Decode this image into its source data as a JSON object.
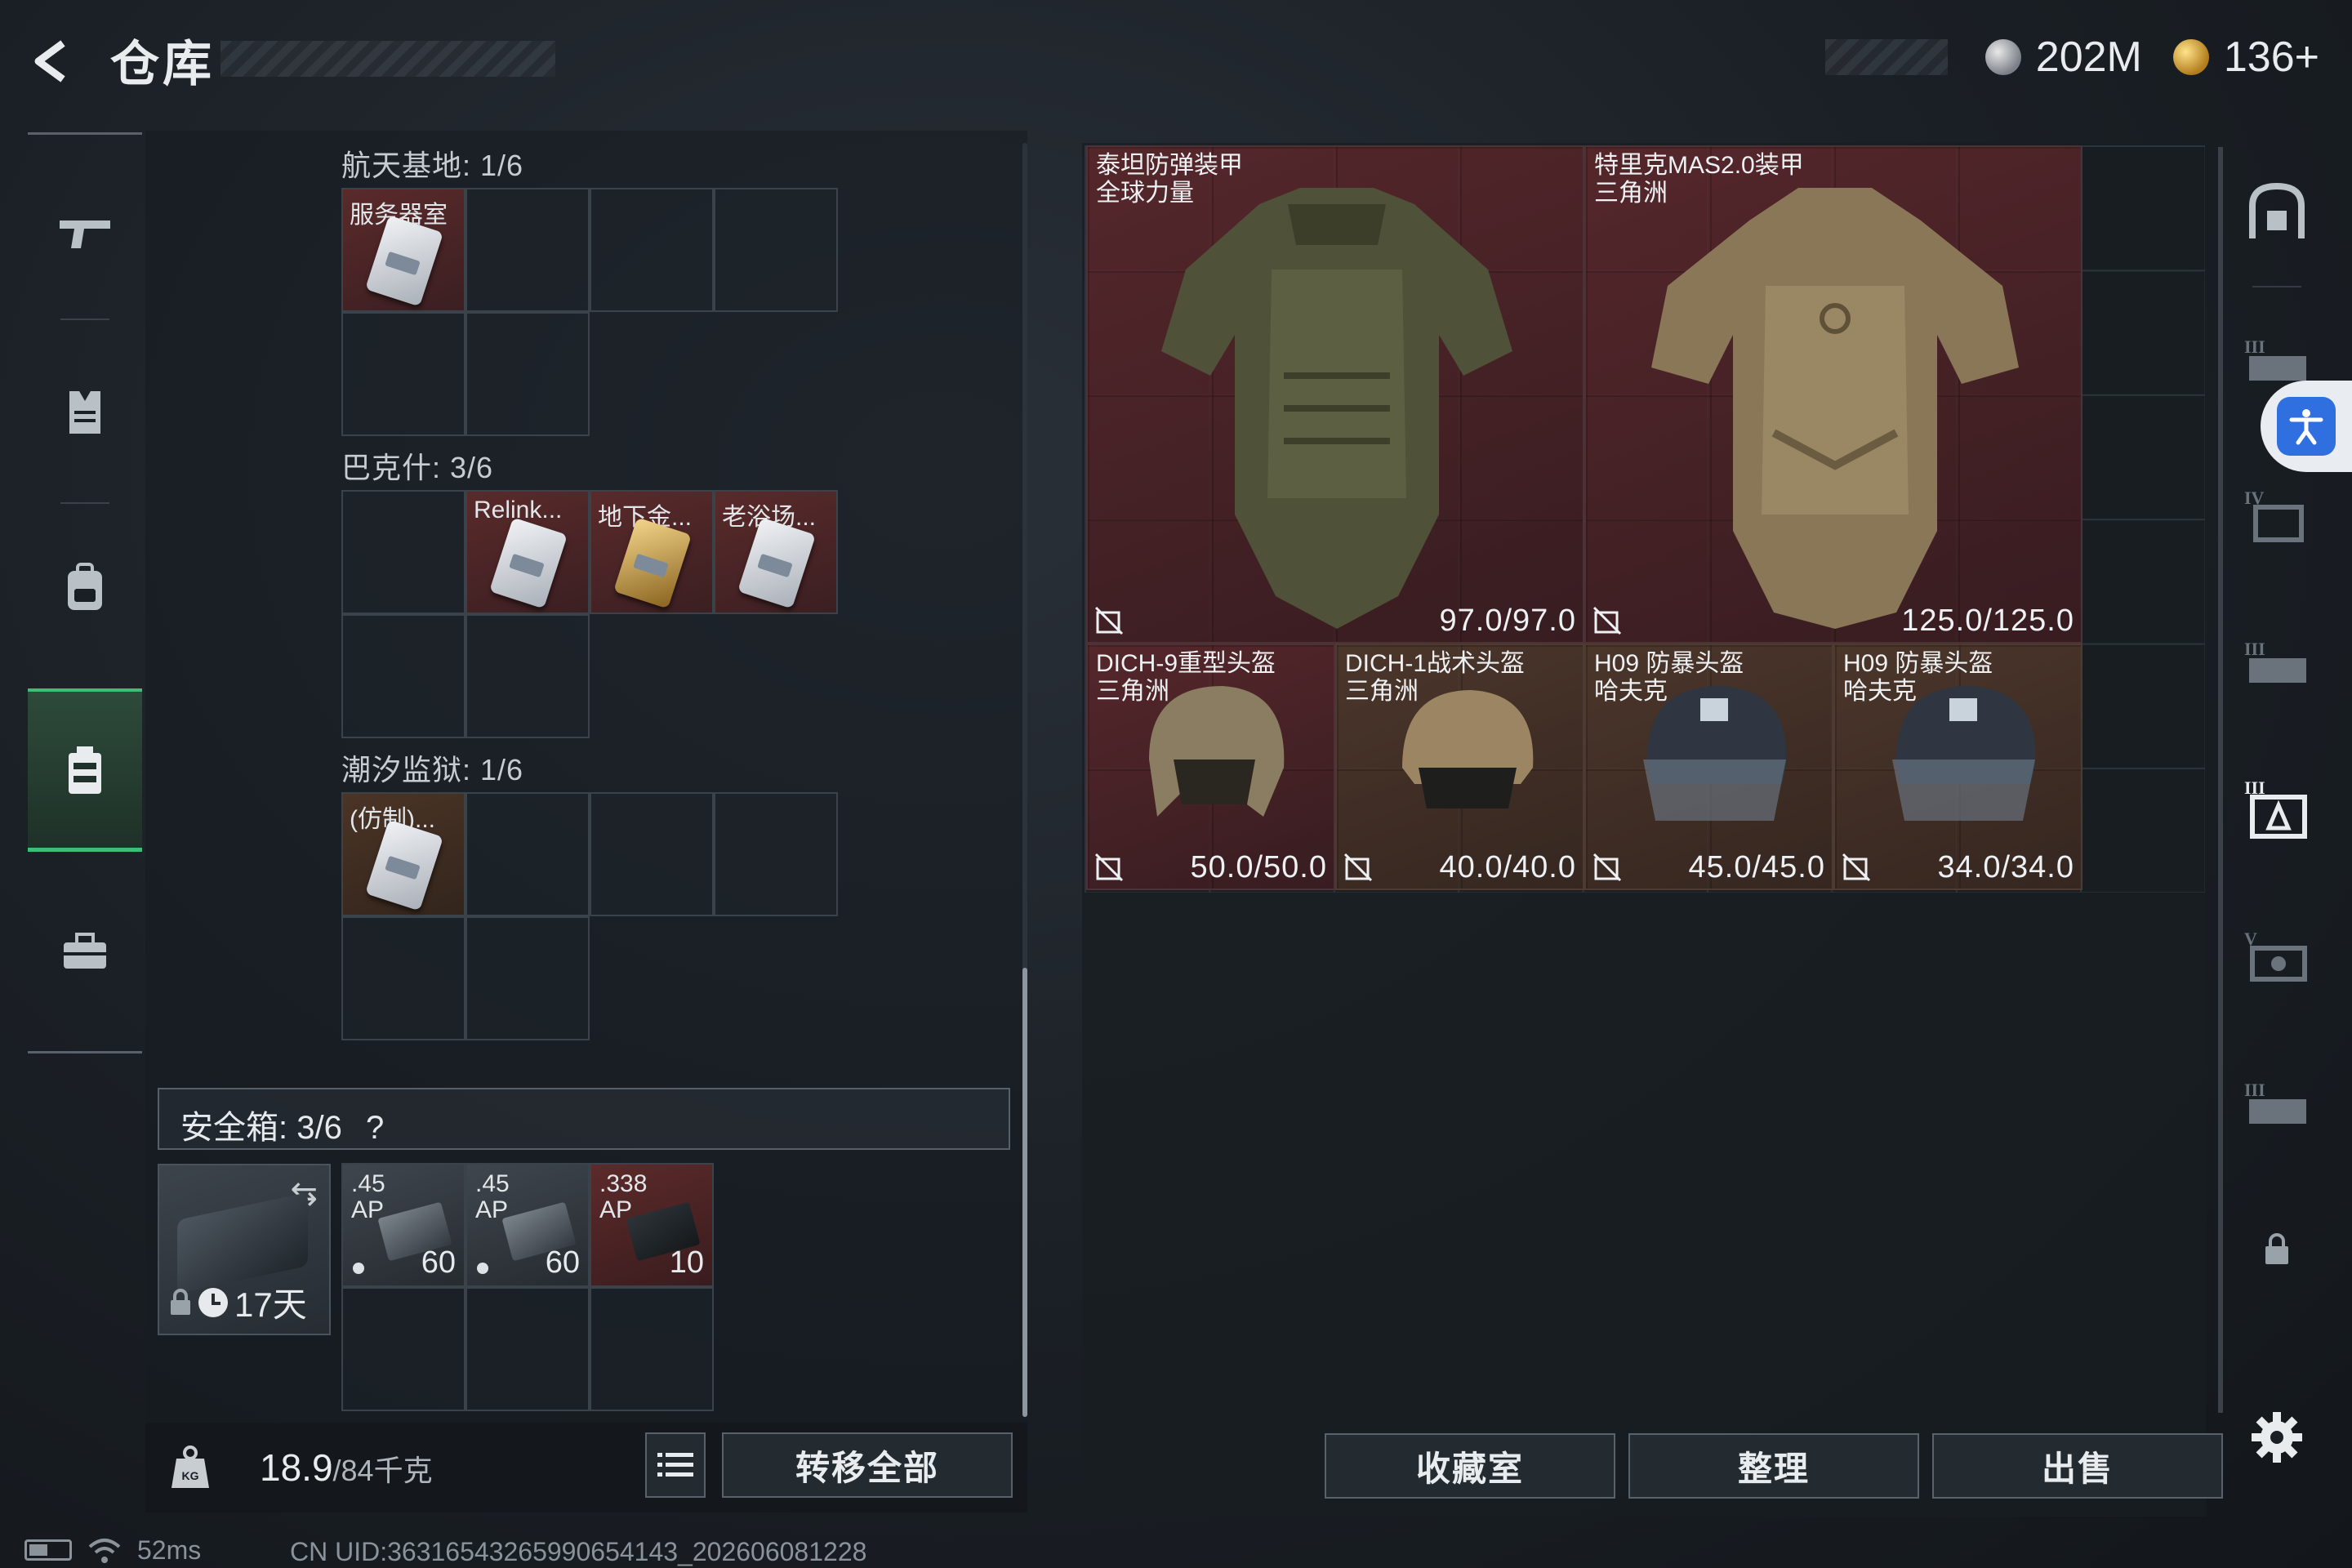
{
  "header": {
    "title": "仓库",
    "currency": [
      {
        "icon": "silver-coin-icon",
        "value": "202M"
      },
      {
        "icon": "gold-coin-icon",
        "value": "136+"
      }
    ]
  },
  "left_rail": {
    "items": [
      {
        "icon": "weapon-icon"
      },
      {
        "icon": "vest-icon"
      },
      {
        "icon": "backpack-icon"
      },
      {
        "icon": "key-card-case-icon",
        "active": true
      },
      {
        "icon": "toolbox-icon"
      }
    ]
  },
  "storage": {
    "sections": [
      {
        "label": "航天基地: 1/6",
        "items": [
          "服务器室"
        ]
      },
      {
        "label": "巴克什: 3/6",
        "items": [
          "Relink...",
          "地下金...",
          "老浴场..."
        ]
      },
      {
        "label": "潮汐监狱: 1/6",
        "items": [
          "(仿制)..."
        ]
      }
    ],
    "safe_box": {
      "label": "安全箱:  3/6",
      "help": "?",
      "case_days": "17天",
      "ammo": [
        {
          "caliber": ".45\nAP",
          "qty": "60"
        },
        {
          "caliber": ".45\nAP",
          "qty": "60"
        },
        {
          "caliber": ".338\nAP",
          "qty": "10"
        }
      ]
    },
    "weight": {
      "current": "18.9",
      "max": "/84千克"
    },
    "transfer_all": "转移全部"
  },
  "stash": {
    "armor": [
      {
        "name": "泰坦防弹装甲\n全球力量",
        "durability": "97.0/97.0"
      },
      {
        "name": "特里克MAS2.0装甲\n三角洲",
        "durability": "125.0/125.0"
      }
    ],
    "helmets": [
      {
        "name": "DICH-9重型头盔\n三角洲",
        "durability": "50.0/50.0"
      },
      {
        "name": "DICH-1战术头盔\n三角洲",
        "durability": "40.0/40.0"
      },
      {
        "name": "H09 防暴头盔\n哈夫克",
        "durability": "45.0/45.0"
      },
      {
        "name": "H09 防暴头盔\n哈夫克",
        "durability": "34.0/34.0"
      }
    ]
  },
  "actions": {
    "collection": "收藏室",
    "sort": "整理",
    "sell": "出售"
  },
  "status_bar": {
    "ping": "52ms",
    "uid": "CN UID:36316543265990654143_202606081228"
  },
  "colors": {
    "accent": "#3dbf73",
    "item_red": "#5a2a2a",
    "accessibility": "#2f6fe0"
  }
}
